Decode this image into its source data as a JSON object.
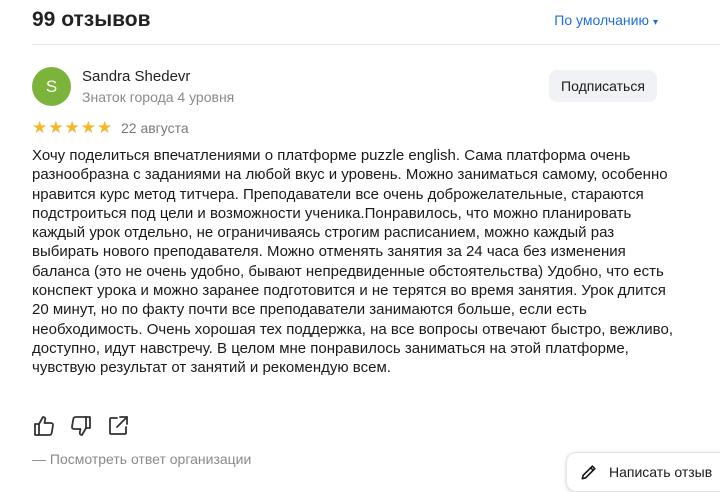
{
  "header": {
    "reviews_count": "99 отзывов",
    "sort_label": "По умолчанию",
    "sort_caret": "▾"
  },
  "review": {
    "author": {
      "initial": "S",
      "name": "Sandra Shedevr",
      "level": "Знаток города 4 уровня",
      "avatar_color": "#7cb33a"
    },
    "subscribe_label": "Подписаться",
    "rating": 5,
    "rating_max": 5,
    "star_glyph": "★",
    "star_color": "#f6b72c",
    "date": "22 августа",
    "text": "Хочу поделиться впечатлениями о платформе puzzle english. Сама платформа очень разнообразна с заданиями на любой вкус и уровень. Можно заниматься самому, особенно нравится курс метод титчера. Преподаватели все очень доброжелательные, стараются подстроиться под цели и возможности ученика.Понравилось, что можно планировать каждый урок отдельно, не ограничиваясь строгим расписанием, можно каждый раз выбирать нового преподавателя. Можно отменять занятия за 24 часа без изменения баланса (это не очень удобно, бывают непредвиденные обстоятельства) Удобно, что есть конспект урока и можно заранее подготовится и не терятся во время занятия. Урок длится 20 минут, но по факту почти все преподаватели занимаются больше, если есть необходимость. Очень хорошая тех поддержка, на все вопросы отвечают быстро, вежливо, доступно, идут навстречу. В целом мне понравилось заниматься на этой платформе, чувствую результат от занятий и рекомендую всем.",
    "actions": {
      "like_icon": "thumbs-up-icon",
      "dislike_icon": "thumbs-down-icon",
      "share_icon": "share-icon"
    },
    "org_reply_label": "— Посмотреть ответ организации"
  },
  "write_review": {
    "label": "Написать отзыв",
    "icon": "pencil-icon"
  },
  "colors": {
    "link": "#1e6fd9",
    "muted": "#8a8a8a"
  }
}
